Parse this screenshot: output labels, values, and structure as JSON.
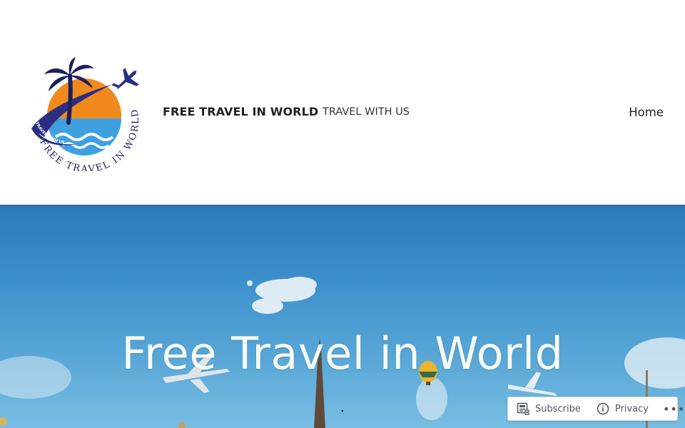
{
  "header": {
    "logo_text": {
      "arc_inner": "TRAVEL WITH US",
      "arc_outer": "FREE TRAVEL IN WORLD"
    },
    "site_title": "FREE TRAVEL IN WORLD",
    "tagline": "TRAVEL WITH US",
    "nav": [
      {
        "label": "Home"
      }
    ]
  },
  "hero": {
    "title": "Free Travel in World"
  },
  "action_bar": {
    "subscribe_label": "Subscribe",
    "privacy_label": "Privacy",
    "more_label": "•••"
  },
  "colors": {
    "sky_top": "#2a79bd",
    "sky_bottom": "#78bde2",
    "logo_navy": "#2b2f82",
    "logo_orange": "#f08a1c",
    "logo_blue": "#3fa0e0"
  },
  "icons": [
    "subscribe-icon",
    "info-icon",
    "more-icon",
    "airplane-icon",
    "palm-tree-icon"
  ]
}
